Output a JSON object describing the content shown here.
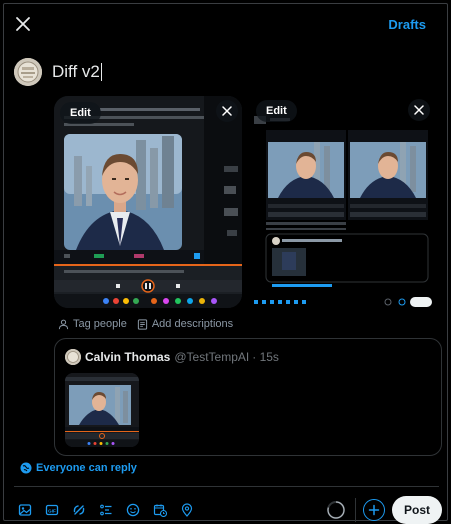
{
  "header": {
    "close_icon": "close-icon",
    "drafts_label": "Drafts"
  },
  "composer": {
    "text": "Diff v2"
  },
  "media": [
    {
      "edit_label": "Edit"
    },
    {
      "edit_label": "Edit"
    }
  ],
  "media_meta": {
    "tag_people": "Tag people",
    "add_descriptions": "Add descriptions"
  },
  "quote": {
    "name": "Calvin Thomas",
    "handle": "@TestTempAI",
    "time": "· 15s"
  },
  "reply_setting": {
    "label": "Everyone can reply"
  },
  "toolbar": {
    "icons": [
      "image-icon",
      "gif-icon",
      "grok-icon",
      "poll-icon",
      "emoji-icon",
      "schedule-icon",
      "location-icon"
    ],
    "post_label": "Post"
  },
  "colors": {
    "accent": "#1d9bf0",
    "background": "#000000",
    "post_button": "#eff3f4"
  }
}
